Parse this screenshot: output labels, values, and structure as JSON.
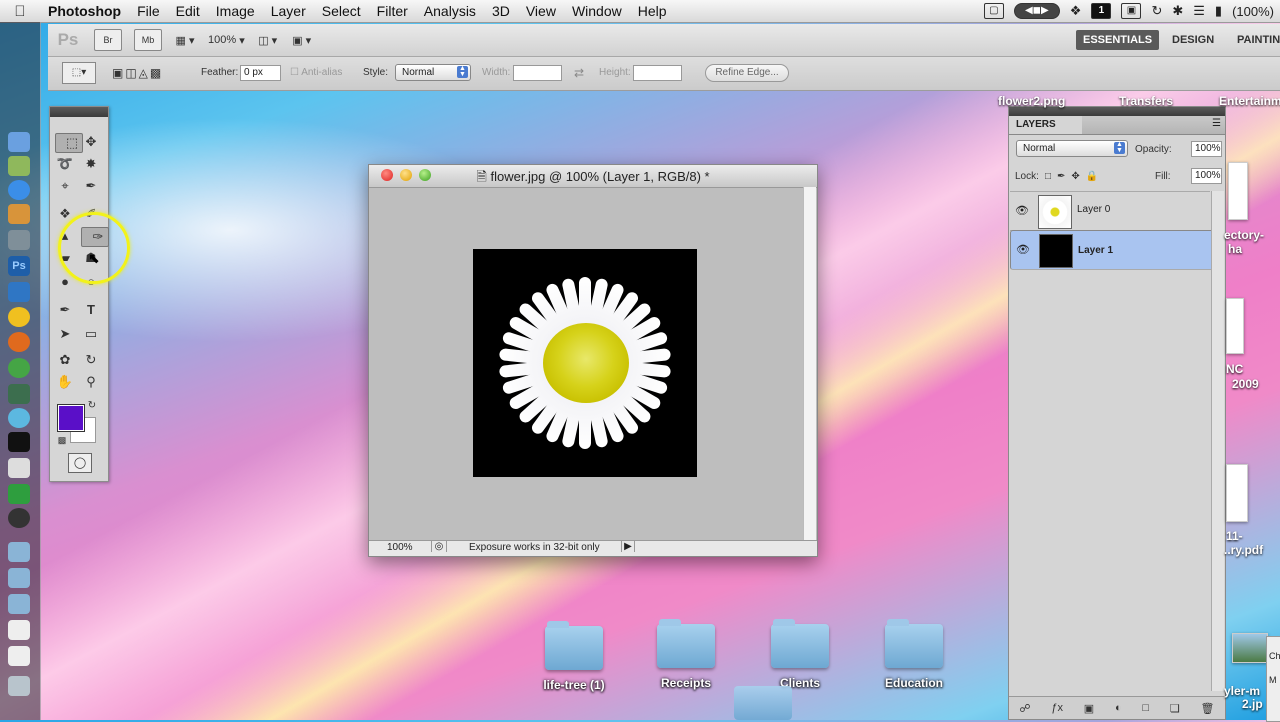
{
  "menubar": {
    "apple": "",
    "items": [
      "Photoshop",
      "File",
      "Edit",
      "Image",
      "Layer",
      "Select",
      "Filter",
      "Analysis",
      "3D",
      "View",
      "Window",
      "Help"
    ],
    "status": {
      "battery": "(100%)",
      "badge": "1"
    }
  },
  "appbar": {
    "logo": "Ps",
    "br": "Br",
    "mb": "Mb",
    "zoom": "100%",
    "workspaces": [
      "ESSENTIALS",
      "DESIGN",
      "PAINTIN"
    ]
  },
  "options": {
    "feather_label": "Feather:",
    "feather_value": "0 px",
    "antialias": "Anti-alias",
    "style_label": "Style:",
    "style_value": "Normal",
    "width_label": "Width:",
    "height_label": "Height:",
    "refine": "Refine Edge..."
  },
  "document": {
    "title": "flower.jpg @ 100% (Layer 1, RGB/8) *",
    "zoom": "100%",
    "status": "Exposure works in 32-bit only"
  },
  "layers": {
    "tab": "LAYERS",
    "blend": "Normal",
    "opacity_label": "Opacity:",
    "opacity": "100%",
    "lock_label": "Lock:",
    "fill_label": "Fill:",
    "fill": "100%",
    "items": [
      {
        "name": "Layer 0",
        "selected": false
      },
      {
        "name": "Layer 1",
        "selected": true
      }
    ]
  },
  "desktop": {
    "folders": [
      "life-tree (1)",
      "Receipts",
      "Clients",
      "Education"
    ],
    "right_labels": [
      "flower2.png",
      "Transfers",
      "Entertainm",
      "ectory-",
      "ha",
      "NC",
      "2009",
      "11-",
      "..ry.pdf",
      "yler-m",
      "2.jp",
      "Ch",
      "M"
    ]
  },
  "colors": {
    "foreground": "#5a0fc8",
    "background": "#ffffff",
    "layer_selected": "#a9c4f0"
  }
}
